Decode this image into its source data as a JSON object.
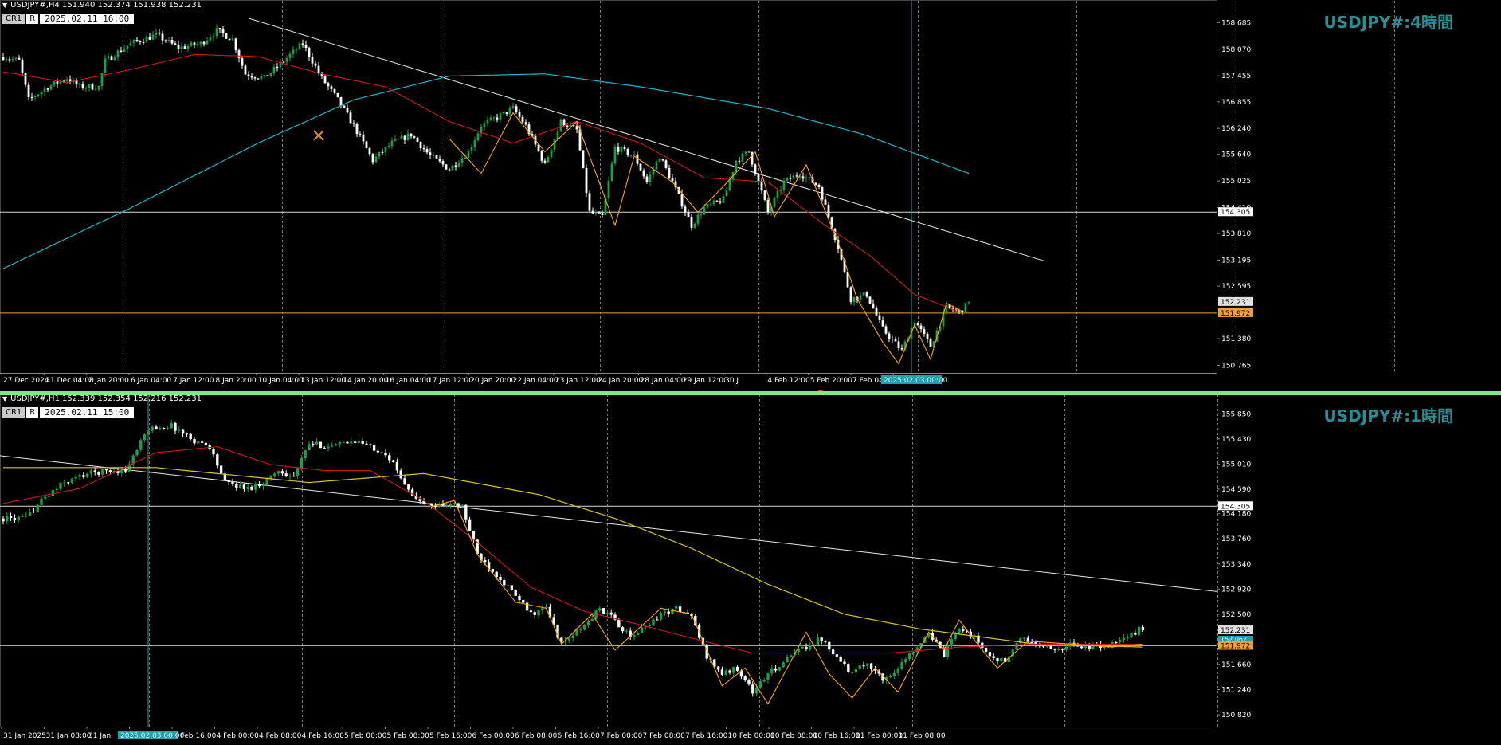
{
  "panels": [
    {
      "symbol_line": "USDJPY#,H4  151.940 152.374 151.938 152.231",
      "box_a": "CR1",
      "box_b": "R",
      "box_date": "2025.02.11 16:00",
      "title": "USDJPY#:4時間",
      "price_labels": [
        "158.685",
        "158.070",
        "157.455",
        "156.855",
        "156.240",
        "155.640",
        "155.025",
        "154.410",
        "153.810",
        "153.195",
        "152.595",
        "151.995",
        "151.380",
        "150.765"
      ],
      "hline_white": "154.305",
      "current_price": "152.231",
      "hline_orange": "151.972",
      "time_labels": [
        "27 Dec 2024",
        "31 Dec 04:00",
        "2 Jan 20:00",
        "6 Jan 04:00",
        "7 Jan 12:00",
        "8 Jan 20:00",
        "10 Jan 04:00",
        "13 Jan 12:00",
        "14 Jan 20:00",
        "16 Jan 04:00",
        "17 Jan 12:00",
        "20 Jan 20:00",
        "22 Jan 04:00",
        "23 Jan 12:00",
        "24 Jan 20:00",
        "28 Jan 04:00",
        "29 Jan 12:00",
        "30 J",
        "4 Feb 12:00",
        "5 Feb 20:00",
        "7 Feb 04:00",
        "10 Feb 12:00"
      ],
      "cursor_time": "2025.02.03 00:00"
    },
    {
      "symbol_line": "USDJPY#,H1  152.339 152.354 152.216 152.231",
      "box_a": "CR1",
      "box_b": "R",
      "box_date": "2025.02.11 15:00",
      "title": "USDJPY#:1時間",
      "price_labels": [
        "155.850",
        "155.430",
        "155.010",
        "154.590",
        "154.180",
        "153.760",
        "153.340",
        "152.920",
        "152.500",
        "152.080",
        "151.660",
        "151.240",
        "150.820"
      ],
      "hline_white": "154.305",
      "current_price": "152.231",
      "extra_price": "152.062",
      "hline_orange": "151.972",
      "time_labels": [
        "31 Jan 2025",
        "31 Jan 08:00",
        "31 Jan",
        "3 Feb 08:00",
        "3 Feb 16:00",
        "4 Feb 00:00",
        "4 Feb 08:00",
        "4 Feb 16:00",
        "5 Feb 00:00",
        "5 Feb 08:00",
        "5 Feb 16:00",
        "6 Feb 00:00",
        "6 Feb 08:00",
        "6 Feb 16:00",
        "7 Feb 00:00",
        "7 Feb 08:00",
        "7 Feb 16:00",
        "10 Feb 00:00",
        "10 Feb 08:00",
        "10 Feb 16:00",
        "11 Feb 00:00",
        "11 Feb 08:00"
      ],
      "cursor_time": "2025.02.03 00:00"
    }
  ],
  "colors": {
    "background": "#000000",
    "bull": "#1fa046",
    "bear": "#ffffff",
    "ma_fast": "#d01818",
    "ma_slow_h4": "#20b6c8",
    "ma_slow_h1": "#d6c71e",
    "zigzag": "#ffa500",
    "trendline": "#e8e8e8",
    "hline_white": "#d9d9d9",
    "hline_orange": "#f0a030",
    "grid": "#7a7a7a",
    "cursor": "#24a0ad",
    "current_label_bg": "#e0e0e0",
    "orange_label_bg": "#f0a030",
    "title": "#2a8c95",
    "divider": "#7fe87f"
  },
  "chart_data": [
    {
      "type": "candlestick",
      "symbol": "USDJPY#",
      "timeframe": "H4",
      "ylim": [
        150.7,
        158.95
      ],
      "hlines": [
        154.305,
        151.972
      ],
      "last": 152.231,
      "close_anchors": [
        [
          0,
          157.9
        ],
        [
          5,
          157.8
        ],
        [
          8,
          156.9
        ],
        [
          14,
          157.2
        ],
        [
          20,
          157.4
        ],
        [
          24,
          157.2
        ],
        [
          30,
          157.2
        ],
        [
          32,
          157.8
        ],
        [
          40,
          158.2
        ],
        [
          48,
          158.4
        ],
        [
          55,
          158.1
        ],
        [
          62,
          158.2
        ],
        [
          67,
          158.5
        ],
        [
          72,
          158.3
        ],
        [
          76,
          157.5
        ],
        [
          82,
          157.4
        ],
        [
          88,
          157.8
        ],
        [
          94,
          158.2
        ],
        [
          100,
          157.4
        ],
        [
          105,
          156.9
        ],
        [
          110,
          156.3
        ],
        [
          116,
          155.5
        ],
        [
          122,
          155.9
        ],
        [
          128,
          156.1
        ],
        [
          134,
          155.6
        ],
        [
          140,
          155.3
        ],
        [
          146,
          155.7
        ],
        [
          150,
          156.3
        ],
        [
          160,
          156.7
        ],
        [
          164,
          156.3
        ],
        [
          170,
          155.4
        ],
        [
          175,
          156.4
        ],
        [
          180,
          156.2
        ],
        [
          184,
          154.3
        ],
        [
          188,
          154.2
        ],
        [
          192,
          155.8
        ],
        [
          198,
          155.6
        ],
        [
          202,
          155.0
        ],
        [
          206,
          155.6
        ],
        [
          210,
          155.0
        ],
        [
          216,
          154.0
        ],
        [
          220,
          154.4
        ],
        [
          226,
          154.6
        ],
        [
          230,
          155.5
        ],
        [
          234,
          155.7
        ],
        [
          240,
          154.3
        ],
        [
          245,
          155.0
        ],
        [
          250,
          155.2
        ],
        [
          256,
          154.9
        ],
        [
          262,
          153.5
        ],
        [
          266,
          152.3
        ],
        [
          271,
          152.4
        ],
        [
          276,
          151.6
        ],
        [
          282,
          151.1
        ],
        [
          286,
          151.8
        ],
        [
          291,
          151.2
        ],
        [
          296,
          152.1
        ],
        [
          300,
          152.0
        ],
        [
          303,
          152.2
        ]
      ],
      "ma_fast_anchors": [
        [
          0,
          157.55
        ],
        [
          20,
          157.3
        ],
        [
          40,
          157.6
        ],
        [
          60,
          157.95
        ],
        [
          80,
          157.9
        ],
        [
          100,
          157.5
        ],
        [
          120,
          157.2
        ],
        [
          140,
          156.4
        ],
        [
          160,
          155.9
        ],
        [
          180,
          156.4
        ],
        [
          200,
          155.9
        ],
        [
          220,
          155.1
        ],
        [
          240,
          155.0
        ],
        [
          258,
          154.0
        ],
        [
          272,
          153.3
        ],
        [
          286,
          152.4
        ],
        [
          300,
          152.0
        ],
        [
          303,
          152.0
        ]
      ],
      "ma_slow_anchors": [
        [
          0,
          153.0
        ],
        [
          40,
          154.4
        ],
        [
          80,
          155.9
        ],
        [
          110,
          156.9
        ],
        [
          140,
          157.45
        ],
        [
          170,
          157.5
        ],
        [
          200,
          157.2
        ],
        [
          240,
          156.7
        ],
        [
          270,
          156.1
        ],
        [
          303,
          155.2
        ]
      ],
      "zigzag": [
        [
          140,
          156.0
        ],
        [
          150,
          155.2
        ],
        [
          160,
          156.6
        ],
        [
          170,
          155.7
        ],
        [
          180,
          156.4
        ],
        [
          192,
          154.0
        ],
        [
          198,
          155.6
        ],
        [
          210,
          155.0
        ],
        [
          218,
          154.3
        ],
        [
          226,
          154.9
        ],
        [
          236,
          155.7
        ],
        [
          242,
          154.2
        ],
        [
          252,
          155.4
        ],
        [
          262,
          153.6
        ],
        [
          268,
          152.3
        ],
        [
          276,
          151.3
        ],
        [
          281,
          150.8
        ],
        [
          286,
          151.7
        ],
        [
          291,
          150.9
        ],
        [
          296,
          152.2
        ],
        [
          301,
          152.0
        ]
      ],
      "trendline": [
        [
          0,
          158.78
        ],
        [
          1,
          153.18
        ]
      ],
      "labels": {
        "title": "USDJPY#:4時間"
      }
    },
    {
      "type": "candlestick",
      "symbol": "USDJPY#",
      "timeframe": "H1",
      "ylim": [
        150.7,
        156.0
      ],
      "hlines": [
        154.305,
        151.972
      ],
      "last": 152.231,
      "close_anchors": [
        [
          0,
          154.1
        ],
        [
          6,
          154.1
        ],
        [
          10,
          154.4
        ],
        [
          16,
          154.7
        ],
        [
          22,
          154.85
        ],
        [
          28,
          154.9
        ],
        [
          32,
          154.9
        ],
        [
          38,
          155.6
        ],
        [
          44,
          155.65
        ],
        [
          50,
          155.4
        ],
        [
          54,
          155.3
        ],
        [
          58,
          154.7
        ],
        [
          64,
          154.6
        ],
        [
          68,
          154.7
        ],
        [
          72,
          154.9
        ],
        [
          76,
          154.8
        ],
        [
          80,
          155.35
        ],
        [
          86,
          155.3
        ],
        [
          92,
          155.4
        ],
        [
          96,
          155.3
        ],
        [
          100,
          155.2
        ],
        [
          104,
          154.8
        ],
        [
          108,
          154.4
        ],
        [
          112,
          154.3
        ],
        [
          116,
          154.35
        ],
        [
          120,
          154.3
        ],
        [
          124,
          153.5
        ],
        [
          130,
          153.1
        ],
        [
          134,
          152.8
        ],
        [
          138,
          152.5
        ],
        [
          142,
          152.6
        ],
        [
          146,
          152.0
        ],
        [
          152,
          152.3
        ],
        [
          156,
          152.6
        ],
        [
          160,
          152.4
        ],
        [
          164,
          152.1
        ],
        [
          168,
          152.3
        ],
        [
          172,
          152.5
        ],
        [
          176,
          152.6
        ],
        [
          180,
          152.45
        ],
        [
          184,
          151.8
        ],
        [
          188,
          151.5
        ],
        [
          192,
          151.6
        ],
        [
          196,
          151.2
        ],
        [
          200,
          151.5
        ],
        [
          204,
          151.7
        ],
        [
          208,
          151.9
        ],
        [
          214,
          152.1
        ],
        [
          218,
          151.8
        ],
        [
          222,
          151.5
        ],
        [
          226,
          151.7
        ],
        [
          230,
          151.4
        ],
        [
          234,
          151.6
        ],
        [
          238,
          151.9
        ],
        [
          242,
          152.2
        ],
        [
          246,
          151.8
        ],
        [
          250,
          152.3
        ],
        [
          254,
          152.1
        ],
        [
          258,
          151.8
        ],
        [
          262,
          151.7
        ],
        [
          266,
          152.1
        ],
        [
          270,
          152.0
        ],
        [
          274,
          151.9
        ],
        [
          280,
          152.0
        ],
        [
          284,
          151.95
        ],
        [
          290,
          152.0
        ],
        [
          294,
          152.1
        ],
        [
          298,
          152.3
        ]
      ],
      "ma_fast_anchors": [
        [
          0,
          154.35
        ],
        [
          20,
          154.6
        ],
        [
          40,
          155.2
        ],
        [
          56,
          155.3
        ],
        [
          70,
          155.0
        ],
        [
          84,
          154.9
        ],
        [
          96,
          154.9
        ],
        [
          110,
          154.4
        ],
        [
          124,
          153.7
        ],
        [
          138,
          152.95
        ],
        [
          152,
          152.55
        ],
        [
          168,
          152.3
        ],
        [
          180,
          152.1
        ],
        [
          196,
          151.85
        ],
        [
          214,
          151.85
        ],
        [
          232,
          151.85
        ],
        [
          250,
          151.95
        ],
        [
          270,
          152.0
        ],
        [
          298,
          152.0
        ]
      ],
      "ma_slow_anchors": [
        [
          0,
          154.95
        ],
        [
          40,
          154.95
        ],
        [
          80,
          154.7
        ],
        [
          110,
          154.85
        ],
        [
          140,
          154.5
        ],
        [
          160,
          154.1
        ],
        [
          180,
          153.6
        ],
        [
          200,
          153.0
        ],
        [
          220,
          152.5
        ],
        [
          240,
          152.25
        ],
        [
          270,
          152.0
        ],
        [
          298,
          151.95
        ]
      ],
      "zigzag": [
        [
          112,
          154.3
        ],
        [
          118,
          154.4
        ],
        [
          124,
          153.5
        ],
        [
          134,
          152.7
        ],
        [
          142,
          152.6
        ],
        [
          146,
          152.0
        ],
        [
          154,
          152.5
        ],
        [
          160,
          151.9
        ],
        [
          172,
          152.6
        ],
        [
          180,
          152.5
        ],
        [
          188,
          151.3
        ],
        [
          194,
          151.6
        ],
        [
          200,
          151.0
        ],
        [
          210,
          152.2
        ],
        [
          216,
          151.5
        ],
        [
          222,
          151.1
        ],
        [
          228,
          151.6
        ],
        [
          234,
          151.2
        ],
        [
          242,
          152.2
        ],
        [
          246,
          151.9
        ],
        [
          250,
          152.4
        ],
        [
          256,
          151.9
        ],
        [
          260,
          151.6
        ],
        [
          268,
          152.05
        ],
        [
          290,
          151.95
        ],
        [
          298,
          152.0
        ]
      ],
      "trendline": [
        [
          0,
          155.15
        ],
        [
          1,
          152.88
        ]
      ],
      "labels": {
        "title": "USDJPY#:1時間"
      }
    }
  ]
}
